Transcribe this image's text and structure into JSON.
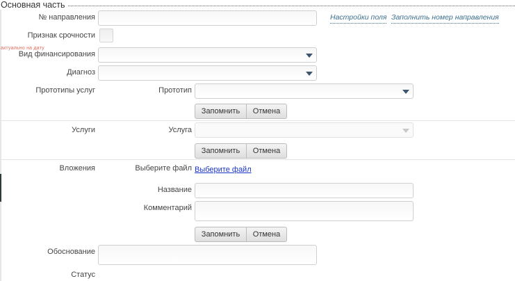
{
  "section": {
    "title": "Основная часть",
    "small_note": "актуально на дату"
  },
  "form": {
    "direction_number_label": "№ направления",
    "field_settings_link": "Настройки поля",
    "fill_number_link": "Заполнить номер направления",
    "urgency_label": "Признак срочности",
    "financing_label": "Вид финансирования",
    "diagnosis_label": "Диагноз",
    "service_prototypes_label": "Прототипы услуг",
    "prototype_label": "Прототип",
    "services_label": "Услуги",
    "service_label": "Услуга",
    "attachments_label": "Вложения",
    "choose_file_label": "Выберите файл",
    "choose_file_link": "Выберите файл",
    "name_label": "Название",
    "comment_label": "Комментарий",
    "justification_label": "Обоснование",
    "status_label": "Статус"
  },
  "buttons": {
    "remember": "Запомнить",
    "cancel": "Отмена"
  },
  "colors": {
    "link": "#3d6f8f",
    "file_link": "#1a35c9",
    "caret": "#3d566e"
  }
}
